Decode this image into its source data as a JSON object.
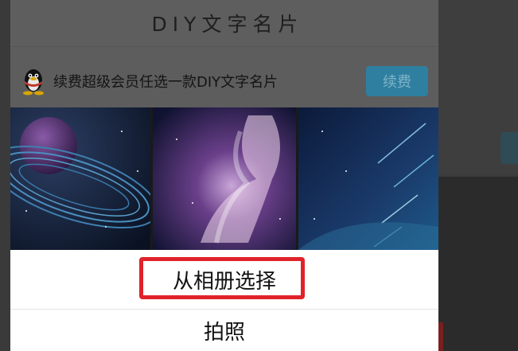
{
  "header": {
    "title": "DIY文字名片"
  },
  "promo": {
    "icon": "qq-penguin-icon",
    "text": "续费超级会员任选一款DIY文字名片",
    "button_label": "续费"
  },
  "gallery": {
    "thumbnails": [
      {
        "name": "planet-ring-thumbnail"
      },
      {
        "name": "nebula-thumbnail"
      },
      {
        "name": "meteor-shower-thumbnail"
      }
    ]
  },
  "action_sheet": {
    "choose_from_album": "从相册选择",
    "take_photo": "拍照"
  },
  "colors": {
    "highlight": "#e0222a",
    "renew_button": "#2f7fa0",
    "sheet_background": "#ffffff"
  }
}
